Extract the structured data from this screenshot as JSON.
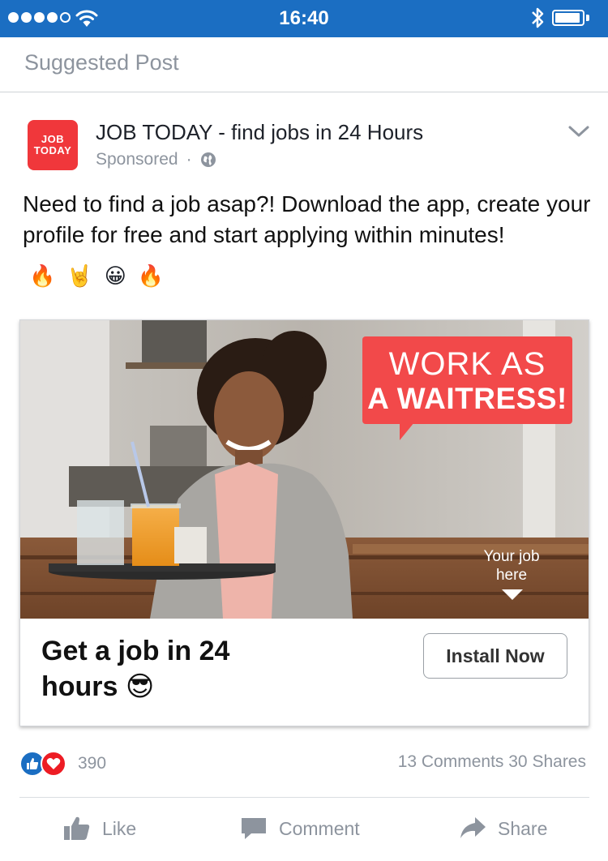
{
  "status_bar": {
    "time": "16:40"
  },
  "header": {
    "suggested_label": "Suggested Post"
  },
  "post": {
    "logo_line1": "JOB",
    "logo_line2": "TODAY",
    "page_name": "JOB TODAY - find jobs in 24 Hours",
    "sponsored": "Sponsored",
    "separator": "·",
    "text": "Need to find a job asap?! Download the app, create your profile for free and start applying within minutes!",
    "emojis": [
      "🔥",
      "🤘",
      "😀",
      "🔥"
    ]
  },
  "ad": {
    "bubble_line1": "WORK AS",
    "bubble_line2": "A WAITRESS!",
    "overlay_line1": "Your job",
    "overlay_line2": "here",
    "headline": "Get a job in 24 hours 😎",
    "cta_label": "Install Now"
  },
  "engagement": {
    "reaction_count": "390",
    "comments_shares": "13 Comments 30 Shares"
  },
  "actions": {
    "like": "Like",
    "comment": "Comment",
    "share": "Share"
  },
  "colors": {
    "status_bar": "#1b6ec2",
    "logo_red": "#f0373b",
    "bubble_red": "#f2494a",
    "meta_gray": "#8d949e"
  },
  "icons": [
    "wifi-icon",
    "bluetooth-icon",
    "battery-icon",
    "globe-icon",
    "chevron-down-icon",
    "like-reaction-icon",
    "love-reaction-icon",
    "thumbs-up-icon",
    "comment-icon",
    "share-icon"
  ]
}
